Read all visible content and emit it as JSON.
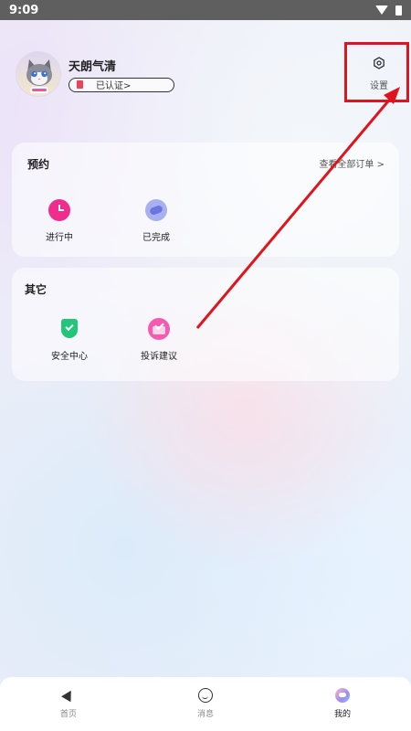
{
  "status_bar": {
    "time": "9:09"
  },
  "profile": {
    "username": "天朗气清",
    "verified_label": "已认证>"
  },
  "settings": {
    "label": "设置"
  },
  "appointments": {
    "title": "预约",
    "view_all": "查看全部订单 >",
    "items": [
      {
        "label": "进行中",
        "icon": "clock-icon"
      },
      {
        "label": "已完成",
        "icon": "handshake-icon"
      }
    ]
  },
  "others": {
    "title": "其它",
    "items": [
      {
        "label": "安全中心",
        "icon": "shield-icon"
      },
      {
        "label": "投诉建议",
        "icon": "complaint-icon"
      }
    ]
  },
  "tabbar": {
    "tabs": [
      {
        "label": "首页",
        "icon": "home-icon"
      },
      {
        "label": "消息",
        "icon": "message-icon"
      },
      {
        "label": "我的",
        "icon": "profile-icon",
        "active": true
      }
    ]
  },
  "colors": {
    "highlight": "#e0141c",
    "accent_pink": "#ee2d8c",
    "shield_green": "#22c57a"
  }
}
